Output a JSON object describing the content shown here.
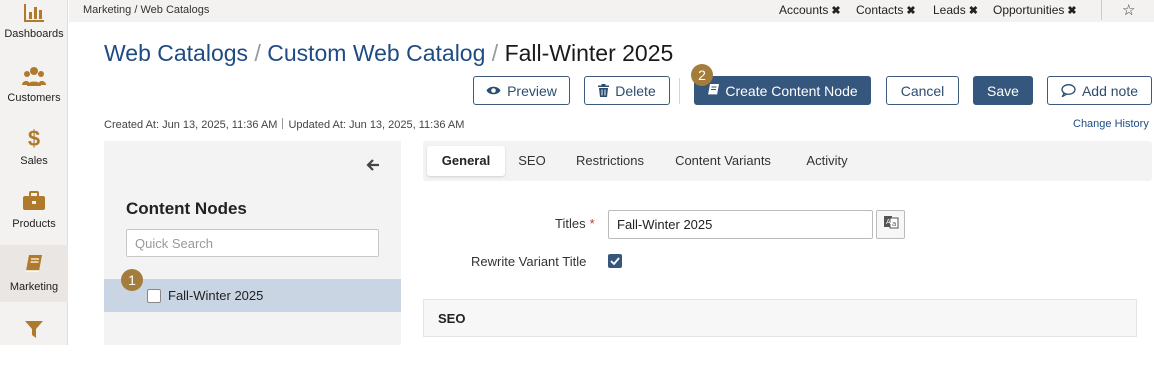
{
  "sidebar": {
    "items": [
      {
        "label": "Dashboards",
        "icon": "bar-chart-icon"
      },
      {
        "label": "Customers",
        "icon": "users-icon"
      },
      {
        "label": "Sales",
        "icon": "dollar-icon"
      },
      {
        "label": "Products",
        "icon": "briefcase-icon"
      },
      {
        "label": "Marketing",
        "icon": "book-icon"
      },
      {
        "label": "",
        "icon": "filter-icon"
      }
    ]
  },
  "topbar": {
    "breadcrumb": "Marketing / Web Catalogs",
    "quick_links": [
      "Accounts",
      "Contacts",
      "Leads",
      "Opportunities"
    ],
    "close_glyph": "✖"
  },
  "header": {
    "title_part1": "Web Catalogs",
    "title_part2": "Custom Web Catalog",
    "title_current": "Fall-Winter 2025",
    "separator": "/"
  },
  "toolbar": {
    "preview": "Preview",
    "delete": "Delete",
    "create_node": "Create Content Node",
    "cancel": "Cancel",
    "save": "Save",
    "add_note": "Add note"
  },
  "badges": {
    "one": "1",
    "two": "2"
  },
  "meta": {
    "created": "Created At: Jun 13, 2025, 11:36 AM",
    "updated": "Updated At: Jun 13, 2025, 11:36 AM",
    "change_history": "Change History"
  },
  "nodes_panel": {
    "title": "Content Nodes",
    "search_placeholder": "Quick Search",
    "items": [
      {
        "label": "Fall-Winter 2025",
        "checked": false,
        "selected": true
      }
    ]
  },
  "tabs": [
    "General",
    "SEO",
    "Restrictions",
    "Content Variants",
    "Activity"
  ],
  "active_tab": "General",
  "form": {
    "titles_label": "Titles",
    "required_mark": "*",
    "titles_value": "Fall-Winter 2025",
    "rewrite_label": "Rewrite Variant Title",
    "rewrite_checked": true,
    "seo_section": "SEO"
  },
  "colors": {
    "accent": "#35567d",
    "link": "#1f4b84",
    "icon_gold": "#b07a2c",
    "badge": "#a47d3c"
  }
}
